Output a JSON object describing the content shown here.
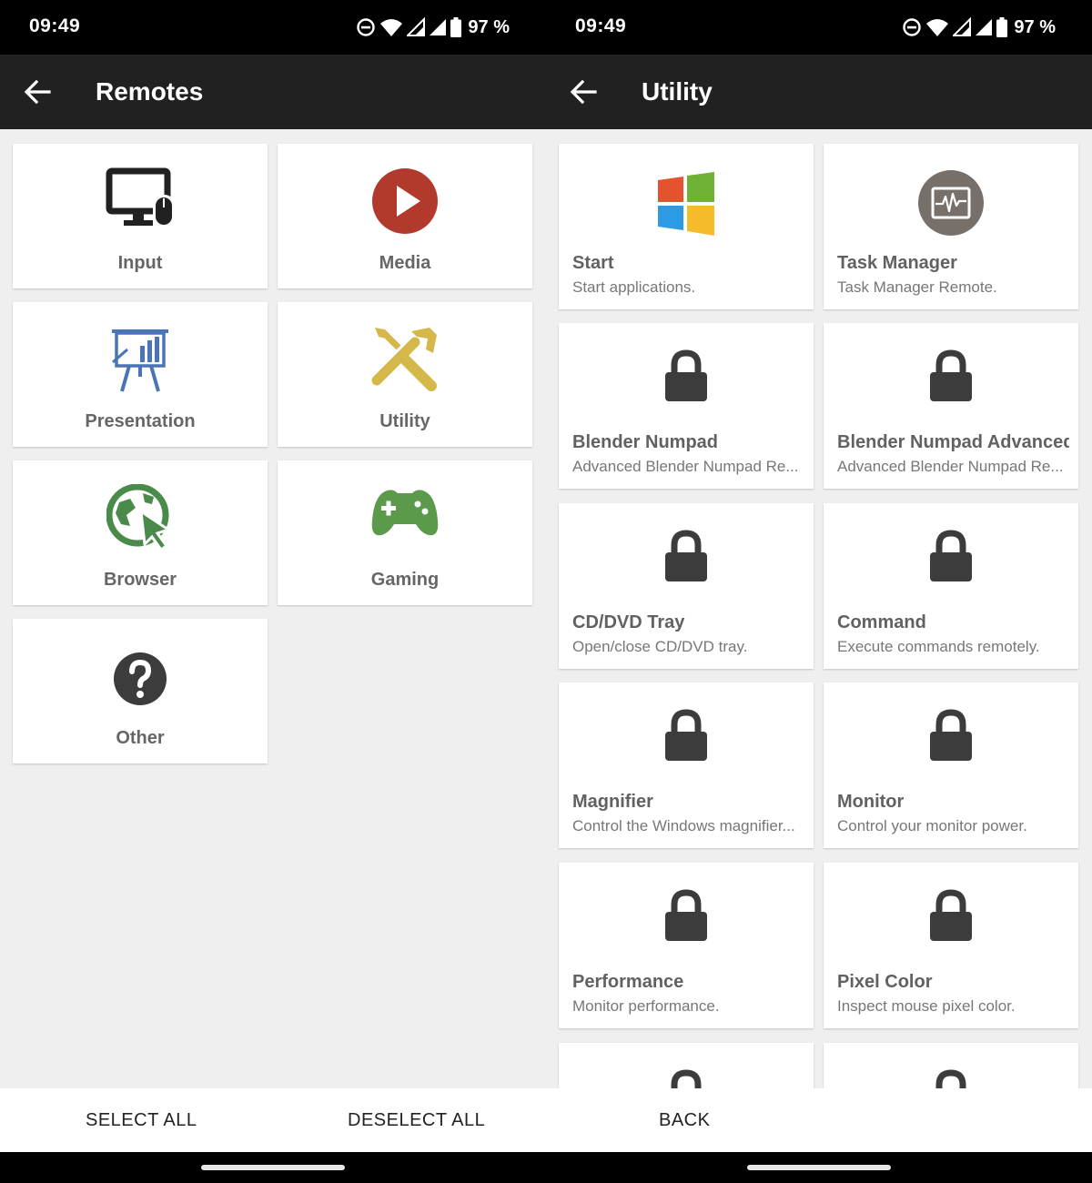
{
  "status_bar": {
    "time": "09:49",
    "battery": "97 %"
  },
  "left": {
    "title": "Remotes",
    "categories": [
      {
        "label": "Input",
        "icon": "monitor-mouse-icon",
        "color": "#212121"
      },
      {
        "label": "Media",
        "icon": "play-icon",
        "color": "#b23a2c"
      },
      {
        "label": "Presentation",
        "icon": "presentation-icon",
        "color": "#4a74b8"
      },
      {
        "label": "Utility",
        "icon": "tools-icon",
        "color": "#d6b84a"
      },
      {
        "label": "Browser",
        "icon": "globe-cursor-icon",
        "color": "#4a8a4a"
      },
      {
        "label": "Gaming",
        "icon": "gamepad-icon",
        "color": "#5a9a4a"
      },
      {
        "label": "Other",
        "icon": "question-icon",
        "color": "#3c3c3c"
      }
    ],
    "select_all": "SELECT ALL",
    "deselect_all": "DESELECT ALL"
  },
  "right": {
    "title": "Utility",
    "remotes": [
      {
        "title": "Start",
        "desc": "Start applications.",
        "icon": "windows-logo-icon"
      },
      {
        "title": "Task Manager",
        "desc": "Task Manager Remote.",
        "icon": "activity-monitor-icon"
      },
      {
        "title": "Blender Numpad",
        "desc": "Advanced Blender Numpad Re...",
        "icon": "lock-icon"
      },
      {
        "title": "Blender Numpad Advanced",
        "desc": "Advanced Blender Numpad Re...",
        "icon": "lock-icon"
      },
      {
        "title": "CD/DVD Tray",
        "desc": "Open/close CD/DVD tray.",
        "icon": "lock-icon"
      },
      {
        "title": "Command",
        "desc": "Execute commands remotely.",
        "icon": "lock-icon"
      },
      {
        "title": "Magnifier",
        "desc": "Control the Windows magnifier...",
        "icon": "lock-icon"
      },
      {
        "title": "Monitor",
        "desc": "Control your monitor power.",
        "icon": "lock-icon"
      },
      {
        "title": "Performance",
        "desc": "Monitor performance.",
        "icon": "lock-icon"
      },
      {
        "title": "Pixel Color",
        "desc": "Inspect mouse pixel color.",
        "icon": "lock-icon"
      }
    ],
    "back": "BACK"
  },
  "colors": {
    "app_bar": "#212121",
    "background": "#efefef",
    "lock": "#3c3c3c"
  }
}
